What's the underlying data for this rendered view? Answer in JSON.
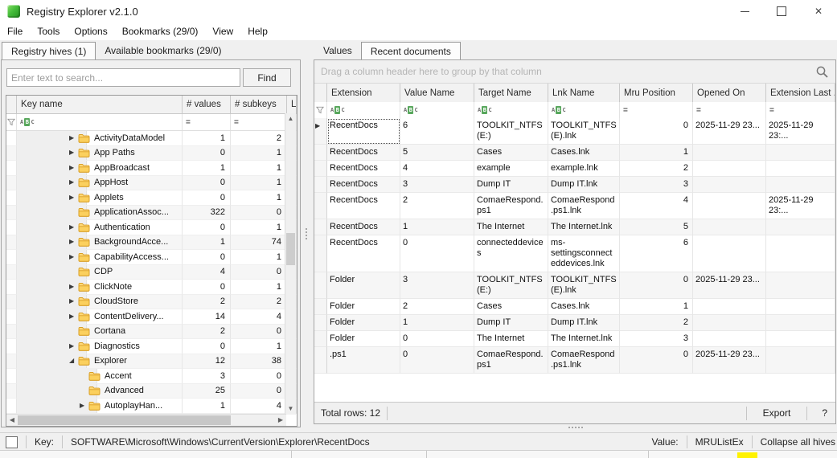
{
  "window": {
    "title": "Registry Explorer v2.1.0"
  },
  "menu": {
    "items": [
      "File",
      "Tools",
      "Options",
      "Bookmarks (29/0)",
      "View",
      "Help"
    ]
  },
  "left_tabs": [
    {
      "label": "Registry hives (1)",
      "selected": true
    },
    {
      "label": "Available bookmarks (29/0)",
      "selected": false
    }
  ],
  "search": {
    "placeholder": "Enter text to search...",
    "find_label": "Find"
  },
  "tree": {
    "columns": [
      "Key name",
      "# values",
      "# subkeys",
      "Las"
    ],
    "rows": [
      {
        "name": "ActivityDataModel",
        "values": "1",
        "subkeys": "2",
        "exp": "c",
        "lvl": 0
      },
      {
        "name": "App Paths",
        "values": "0",
        "subkeys": "1",
        "exp": "c",
        "lvl": 0
      },
      {
        "name": "AppBroadcast",
        "values": "1",
        "subkeys": "1",
        "exp": "c",
        "lvl": 0
      },
      {
        "name": "AppHost",
        "values": "0",
        "subkeys": "1",
        "exp": "c",
        "lvl": 0
      },
      {
        "name": "Applets",
        "values": "0",
        "subkeys": "1",
        "exp": "c",
        "lvl": 0
      },
      {
        "name": "ApplicationAssoc...",
        "values": "322",
        "subkeys": "0",
        "exp": "n",
        "lvl": 0
      },
      {
        "name": "Authentication",
        "values": "0",
        "subkeys": "1",
        "exp": "c",
        "lvl": 0
      },
      {
        "name": "BackgroundAcce...",
        "values": "1",
        "subkeys": "74",
        "exp": "c",
        "lvl": 0
      },
      {
        "name": "CapabilityAccess...",
        "values": "0",
        "subkeys": "1",
        "exp": "c",
        "lvl": 0
      },
      {
        "name": "CDP",
        "values": "4",
        "subkeys": "0",
        "exp": "n",
        "lvl": 0
      },
      {
        "name": "ClickNote",
        "values": "0",
        "subkeys": "1",
        "exp": "c",
        "lvl": 0
      },
      {
        "name": "CloudStore",
        "values": "2",
        "subkeys": "2",
        "exp": "c",
        "lvl": 0
      },
      {
        "name": "ContentDelivery...",
        "values": "14",
        "subkeys": "4",
        "exp": "c",
        "lvl": 0
      },
      {
        "name": "Cortana",
        "values": "2",
        "subkeys": "0",
        "exp": "n",
        "lvl": 0
      },
      {
        "name": "Diagnostics",
        "values": "0",
        "subkeys": "1",
        "exp": "c",
        "lvl": 0
      },
      {
        "name": "Explorer",
        "values": "12",
        "subkeys": "38",
        "exp": "e",
        "lvl": 0
      },
      {
        "name": "Accent",
        "values": "3",
        "subkeys": "0",
        "exp": "n",
        "lvl": 1
      },
      {
        "name": "Advanced",
        "values": "25",
        "subkeys": "0",
        "exp": "n",
        "lvl": 1
      },
      {
        "name": "AutoplayHan...",
        "values": "1",
        "subkeys": "4",
        "exp": "c",
        "lvl": 1
      }
    ]
  },
  "right_tabs": [
    {
      "label": "Values",
      "selected": false
    },
    {
      "label": "Recent documents",
      "selected": true
    }
  ],
  "group_bar": {
    "text": "Drag a column header here to group by that column"
  },
  "grid": {
    "columns": [
      "Extension",
      "Value Name",
      "Target Name",
      "Lnk Name",
      "Mru Position",
      "Opened On",
      "Extension Last ..."
    ],
    "selected_row": 0,
    "rows": [
      [
        "RecentDocs",
        "6",
        "TOOLKIT_NTFS (E:)",
        "TOOLKIT_NTFS (E).lnk",
        "0",
        "2025-11-29 23...",
        "2025-11-29 23:..."
      ],
      [
        "RecentDocs",
        "5",
        "Cases",
        "Cases.lnk",
        "1",
        "",
        ""
      ],
      [
        "RecentDocs",
        "4",
        "example",
        "example.lnk",
        "2",
        "",
        ""
      ],
      [
        "RecentDocs",
        "3",
        "Dump IT",
        "Dump IT.lnk",
        "3",
        "",
        ""
      ],
      [
        "RecentDocs",
        "2",
        "ComaeRespond.ps1",
        "ComaeRespond.ps1.lnk",
        "4",
        "",
        "2025-11-29 23:..."
      ],
      [
        "RecentDocs",
        "1",
        "The Internet",
        "The Internet.lnk",
        "5",
        "",
        ""
      ],
      [
        "RecentDocs",
        "0",
        "connecteddevices",
        "ms-settingsconnecteddevices.lnk",
        "6",
        "",
        ""
      ],
      [
        "Folder",
        "3",
        "TOOLKIT_NTFS (E:)",
        "TOOLKIT_NTFS (E).lnk",
        "0",
        "2025-11-29 23...",
        ""
      ],
      [
        "Folder",
        "2",
        "Cases",
        "Cases.lnk",
        "1",
        "",
        ""
      ],
      [
        "Folder",
        "1",
        "Dump IT",
        "Dump IT.lnk",
        "2",
        "",
        ""
      ],
      [
        "Folder",
        "0",
        "The Internet",
        "The Internet.lnk",
        "3",
        "",
        ""
      ],
      [
        ".ps1",
        "0",
        "ComaeRespond.ps1",
        "ComaeRespond.ps1.lnk",
        "0",
        "2025-11-29 23...",
        ""
      ]
    ]
  },
  "grid_footer": {
    "total": "Total rows: 12",
    "export_label": "Export",
    "help_label": "?"
  },
  "status_bar": {
    "key_label": "Key:",
    "key_path": "SOFTWARE\\Microsoft\\Windows\\CurrentVersion\\Explorer\\RecentDocs",
    "value_label": "Value:",
    "value_name": "MRUListEx",
    "collapse_label": "Collapse all hives"
  },
  "colors": {
    "folder_yellow": "#FFD978",
    "filter_green": "#58A75C",
    "highlight_yellow": "#FFF200"
  }
}
